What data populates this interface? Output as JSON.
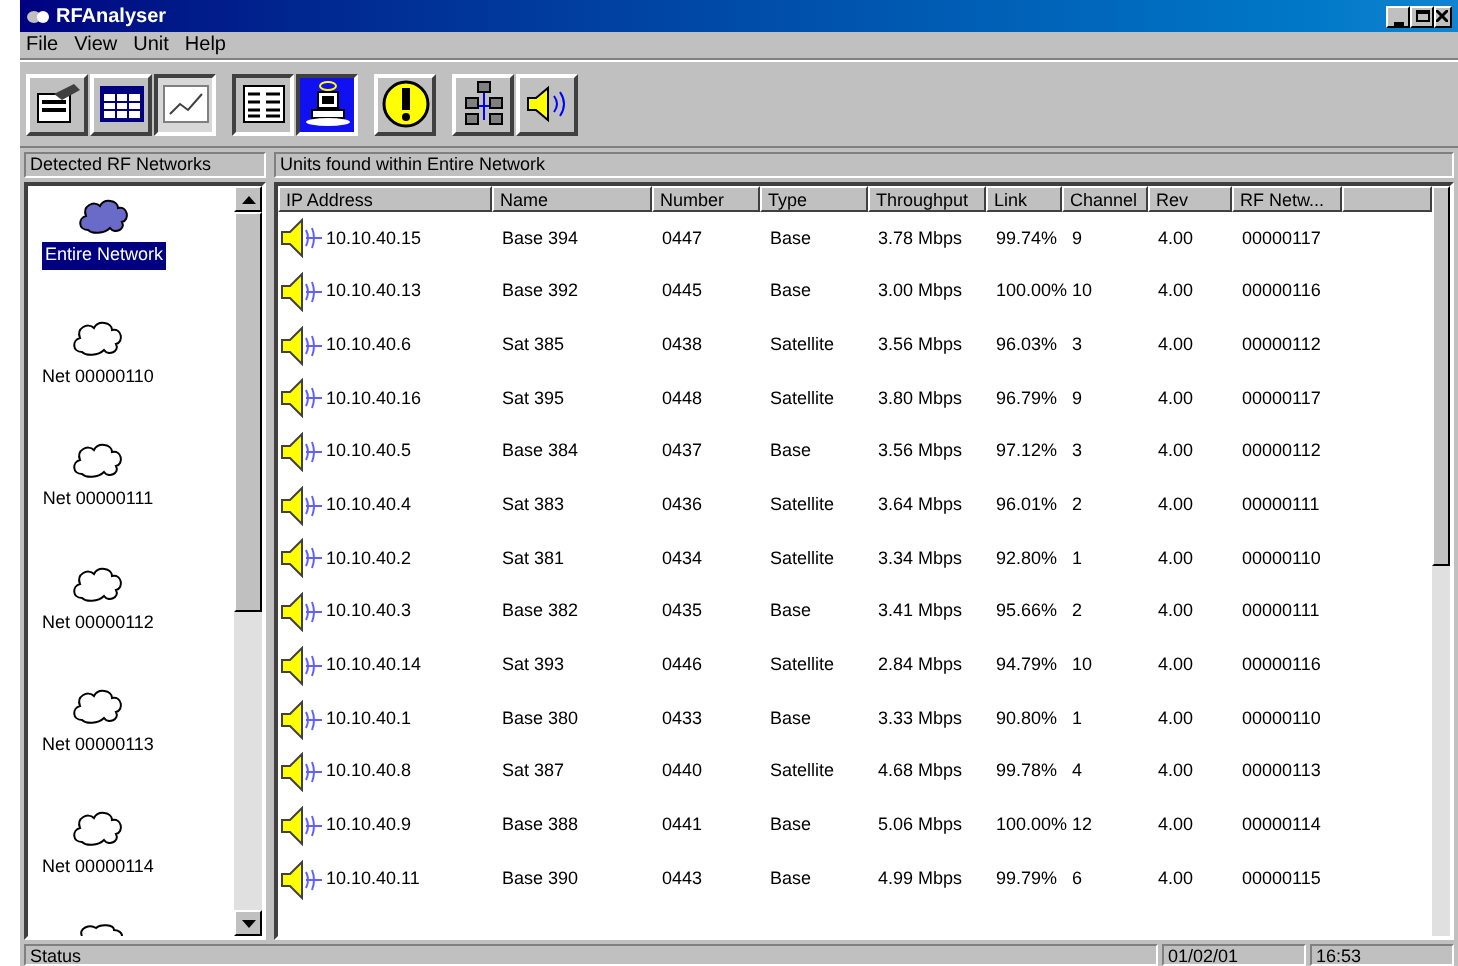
{
  "window": {
    "title": "RFAnalyser"
  },
  "menu": [
    "File",
    "View",
    "Unit",
    "Help"
  ],
  "left_pane": {
    "header": "Detected RF Networks",
    "items": [
      {
        "label": "Entire Network",
        "selected": true
      },
      {
        "label": "Net 00000110",
        "selected": false
      },
      {
        "label": "Net 00000111",
        "selected": false
      },
      {
        "label": "Net 00000112",
        "selected": false
      },
      {
        "label": "Net 00000113",
        "selected": false
      },
      {
        "label": "Net 00000114",
        "selected": false
      }
    ]
  },
  "right_pane": {
    "header": "Units found within Entire Network",
    "table": {
      "columns": [
        "IP Address",
        "Name",
        "Number",
        "Type",
        "Throughput",
        "Link",
        "Channel",
        "Rev",
        "RF Netw..."
      ],
      "rows": [
        [
          "10.10.40.15",
          "Base 394",
          "0447",
          "Base",
          "3.78 Mbps",
          "99.74%",
          "9",
          "4.00",
          "00000117"
        ],
        [
          "10.10.40.13",
          "Base 392",
          "0445",
          "Base",
          "3.00 Mbps",
          "100.00%",
          "10",
          "4.00",
          "00000116"
        ],
        [
          "10.10.40.6",
          "Sat 385",
          "0438",
          "Satellite",
          "3.56 Mbps",
          "96.03%",
          "3",
          "4.00",
          "00000112"
        ],
        [
          "10.10.40.16",
          "Sat 395",
          "0448",
          "Satellite",
          "3.80 Mbps",
          "96.79%",
          "9",
          "4.00",
          "00000117"
        ],
        [
          "10.10.40.5",
          "Base 384",
          "0437",
          "Base",
          "3.56 Mbps",
          "97.12%",
          "3",
          "4.00",
          "00000112"
        ],
        [
          "10.10.40.4",
          "Sat 383",
          "0436",
          "Satellite",
          "3.64 Mbps",
          "96.01%",
          "2",
          "4.00",
          "00000111"
        ],
        [
          "10.10.40.2",
          "Sat 381",
          "0434",
          "Satellite",
          "3.34 Mbps",
          "92.80%",
          "1",
          "4.00",
          "00000110"
        ],
        [
          "10.10.40.3",
          "Base 382",
          "0435",
          "Base",
          "3.41 Mbps",
          "95.66%",
          "2",
          "4.00",
          "00000111"
        ],
        [
          "10.10.40.14",
          "Sat 393",
          "0446",
          "Satellite",
          "2.84 Mbps",
          "94.79%",
          "10",
          "4.00",
          "00000116"
        ],
        [
          "10.10.40.1",
          "Base 380",
          "0433",
          "Base",
          "3.33 Mbps",
          "90.80%",
          "1",
          "4.00",
          "00000110"
        ],
        [
          "10.10.40.8",
          "Sat 387",
          "0440",
          "Satellite",
          "4.68 Mbps",
          "99.78%",
          "4",
          "4.00",
          "00000113"
        ],
        [
          "10.10.40.9",
          "Base 388",
          "0441",
          "Base",
          "5.06 Mbps",
          "100.00%",
          "12",
          "4.00",
          "00000114"
        ],
        [
          "10.10.40.11",
          "Base 390",
          "0443",
          "Base",
          "4.99 Mbps",
          "99.79%",
          "6",
          "4.00",
          "00000115"
        ]
      ]
    }
  },
  "status_bar": {
    "text": "Status",
    "date": "01/02/01",
    "time": "16:53"
  }
}
